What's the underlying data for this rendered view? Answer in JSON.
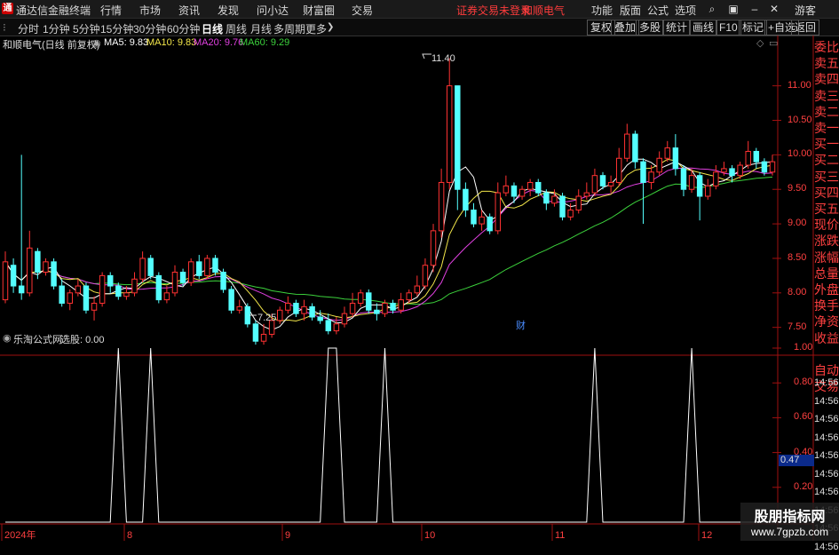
{
  "titlebar": {
    "app_name": "通达信金融终端",
    "menus": [
      "行情",
      "市场",
      "资讯",
      "发现",
      "问小达",
      "财富圈",
      "交易"
    ],
    "warning": "证券交易未登录",
    "stock_name": "和顺电气",
    "right_menus": [
      "功能",
      "版面",
      "公式",
      "选项"
    ],
    "guest": "游客"
  },
  "toolbar": {
    "periods": [
      "分时",
      "1分钟",
      "5分钟",
      "15分钟",
      "30分钟",
      "60分钟",
      "日线",
      "周线",
      "月线",
      "多周期",
      "更多"
    ],
    "active_period": "日线",
    "right_buttons": [
      "复权",
      "叠加",
      "多股",
      "统计",
      "画线",
      "F10",
      "标记",
      "+自选",
      "返回"
    ]
  },
  "main_chart": {
    "title": "和顺电气(日线 前复权)",
    "ma_labels": [
      {
        "text": "MA5: 9.83",
        "color": "#ffffff"
      },
      {
        "text": "MA10: 9.83",
        "color": "#f2e64a"
      },
      {
        "text": "MA20: 9.76",
        "color": "#e040e0"
      },
      {
        "text": "MA60: 9.29",
        "color": "#3cd23c"
      }
    ],
    "high_label": "11.40",
    "low_label": "7.25",
    "event_marker": "财",
    "y_ticks": [
      "11.00",
      "10.50",
      "10.00",
      "9.50",
      "9.00",
      "8.50",
      "8.00",
      "7.50"
    ]
  },
  "sub_chart": {
    "title": "乐淘公式网",
    "value_label": "选股: 0.00",
    "y_ticks": [
      "1.00",
      "0.80",
      "0.60",
      "0.40",
      "0.20"
    ],
    "current_value": "0.47"
  },
  "x_axis": {
    "labels": [
      "2024年",
      "8",
      "9",
      "10",
      "11",
      "12"
    ]
  },
  "right_panel": {
    "items": [
      "委比",
      "卖五",
      "卖四",
      "卖三",
      "卖二",
      "卖一",
      "买一",
      "买二",
      "买三",
      "买四",
      "买五",
      "现价",
      "涨跌",
      "涨幅",
      "总量",
      "外盘",
      "换手",
      "净资",
      "收益",
      "自动",
      "交易",
      "14:56",
      "14:56",
      "14:56",
      "14:56",
      "14:56",
      "14:56",
      "14:56",
      "14:56",
      "14:56",
      "14:56"
    ]
  },
  "watermark": {
    "line1": "股朋指标网",
    "line2": "www.7gpzb.com"
  },
  "chart_data": {
    "type": "candlestick",
    "y_range": [
      7.2,
      11.6
    ],
    "candles": [
      [
        7.9,
        8.45,
        8.6,
        7.85
      ],
      [
        8.4,
        8.1,
        8.5,
        8.0
      ],
      [
        8.1,
        8.0,
        10.0,
        7.9
      ],
      [
        8.0,
        8.65,
        8.9,
        7.95
      ],
      [
        8.6,
        8.3,
        8.65,
        8.2
      ],
      [
        8.3,
        8.45,
        8.5,
        8.25
      ],
      [
        8.45,
        8.1,
        8.5,
        8.05
      ],
      [
        8.1,
        7.85,
        8.2,
        7.8
      ],
      [
        7.85,
        8.0,
        8.05,
        7.75
      ],
      [
        8.0,
        8.1,
        8.2,
        7.95
      ],
      [
        8.1,
        7.75,
        8.15,
        7.7
      ],
      [
        7.75,
        7.85,
        7.95,
        7.6
      ],
      [
        7.85,
        8.25,
        8.3,
        7.8
      ],
      [
        8.25,
        8.1,
        8.3,
        8.0
      ],
      [
        8.1,
        7.95,
        8.15,
        7.9
      ],
      [
        7.95,
        8.0,
        8.1,
        7.9
      ],
      [
        8.0,
        8.2,
        8.3,
        7.95
      ],
      [
        8.2,
        8.5,
        8.6,
        8.15
      ],
      [
        8.5,
        8.25,
        8.55,
        8.2
      ],
      [
        8.25,
        7.9,
        8.3,
        7.85
      ],
      [
        7.9,
        8.0,
        8.1,
        7.85
      ],
      [
        8.0,
        8.3,
        8.4,
        7.95
      ],
      [
        8.3,
        8.15,
        8.35,
        8.1
      ],
      [
        8.15,
        8.45,
        8.5,
        8.1
      ],
      [
        8.45,
        8.25,
        8.55,
        8.2
      ],
      [
        8.25,
        8.5,
        8.55,
        8.2
      ],
      [
        8.5,
        8.3,
        8.55,
        8.25
      ],
      [
        8.3,
        8.05,
        8.35,
        8.0
      ],
      [
        8.05,
        7.75,
        8.1,
        7.7
      ],
      [
        7.75,
        7.8,
        7.9,
        7.7
      ],
      [
        7.8,
        7.55,
        7.85,
        7.5
      ],
      [
        7.55,
        7.3,
        7.6,
        7.25
      ],
      [
        7.3,
        7.4,
        7.55,
        7.25
      ],
      [
        7.4,
        7.6,
        7.7,
        7.35
      ],
      [
        7.6,
        7.75,
        7.8,
        7.55
      ],
      [
        7.75,
        7.85,
        7.95,
        7.7
      ],
      [
        7.85,
        7.7,
        7.9,
        7.65
      ],
      [
        7.7,
        7.8,
        7.9,
        7.6
      ],
      [
        7.8,
        7.65,
        7.85,
        7.6
      ],
      [
        7.65,
        7.6,
        7.75,
        7.55
      ],
      [
        7.6,
        7.45,
        7.7,
        7.4
      ],
      [
        7.45,
        7.55,
        7.65,
        7.4
      ],
      [
        7.55,
        7.7,
        7.8,
        7.5
      ],
      [
        7.7,
        7.85,
        8.0,
        7.65
      ],
      [
        7.85,
        8.0,
        8.05,
        7.8
      ],
      [
        8.0,
        7.75,
        8.05,
        7.7
      ],
      [
        7.75,
        7.7,
        7.85,
        7.6
      ],
      [
        7.7,
        7.85,
        7.9,
        7.65
      ],
      [
        7.85,
        7.75,
        7.9,
        7.7
      ],
      [
        7.75,
        7.9,
        8.0,
        7.7
      ],
      [
        7.9,
        8.0,
        8.05,
        7.85
      ],
      [
        8.0,
        8.1,
        8.25,
        7.95
      ],
      [
        8.1,
        8.4,
        8.5,
        8.05
      ],
      [
        8.4,
        8.9,
        9.0,
        8.3
      ],
      [
        8.9,
        9.6,
        9.8,
        8.8
      ],
      [
        9.6,
        11.0,
        11.4,
        9.5
      ],
      [
        11.0,
        9.5,
        10.2,
        9.2
      ],
      [
        9.5,
        9.2,
        9.6,
        9.1
      ],
      [
        9.2,
        9.0,
        9.3,
        8.95
      ],
      [
        9.0,
        9.1,
        9.2,
        8.9
      ],
      [
        9.1,
        8.9,
        9.15,
        8.85
      ],
      [
        8.9,
        9.45,
        9.6,
        8.85
      ],
      [
        9.45,
        9.55,
        9.7,
        9.4
      ],
      [
        9.55,
        9.4,
        9.6,
        9.3
      ],
      [
        9.4,
        9.5,
        9.55,
        9.35
      ],
      [
        9.5,
        9.6,
        9.65,
        9.4
      ],
      [
        9.6,
        9.45,
        9.65,
        9.4
      ],
      [
        9.45,
        9.3,
        9.5,
        9.2
      ],
      [
        9.3,
        9.4,
        9.5,
        9.25
      ],
      [
        9.4,
        9.1,
        9.45,
        9.05
      ],
      [
        9.1,
        9.2,
        9.3,
        9.05
      ],
      [
        9.2,
        9.4,
        9.5,
        9.15
      ],
      [
        9.4,
        9.45,
        9.6,
        9.35
      ],
      [
        9.45,
        9.7,
        9.8,
        9.4
      ],
      [
        9.7,
        9.55,
        9.75,
        9.5
      ],
      [
        9.55,
        9.6,
        9.7,
        9.45
      ],
      [
        9.6,
        9.95,
        10.1,
        9.55
      ],
      [
        9.95,
        10.3,
        10.45,
        9.9
      ],
      [
        10.3,
        9.9,
        10.35,
        9.8
      ],
      [
        9.9,
        9.6,
        9.95,
        9.0
      ],
      [
        9.6,
        9.75,
        9.85,
        9.5
      ],
      [
        9.75,
        9.95,
        10.05,
        9.7
      ],
      [
        9.95,
        10.1,
        10.2,
        9.9
      ],
      [
        10.1,
        9.8,
        10.3,
        9.7
      ],
      [
        9.8,
        9.5,
        9.85,
        9.4
      ],
      [
        9.5,
        9.7,
        9.8,
        9.45
      ],
      [
        9.7,
        9.4,
        9.75,
        9.05
      ],
      [
        9.4,
        9.55,
        9.65,
        9.35
      ],
      [
        9.55,
        9.75,
        9.85,
        9.5
      ],
      [
        9.75,
        9.8,
        9.9,
        9.7
      ],
      [
        9.8,
        9.7,
        9.85,
        9.6
      ],
      [
        9.7,
        9.85,
        9.9,
        9.65
      ],
      [
        9.85,
        10.05,
        10.2,
        9.8
      ],
      [
        10.05,
        9.9,
        10.1,
        9.8
      ],
      [
        9.9,
        9.75,
        9.95,
        9.7
      ],
      [
        9.75,
        9.9,
        10.0,
        9.7
      ]
    ],
    "ma_colors": {
      "ma5": "#ffffff",
      "ma10": "#f2e64a",
      "ma20": "#e040e0",
      "ma60": "#3cd23c"
    },
    "signal_peaks_index": [
      14,
      18,
      40,
      47,
      73,
      85
    ],
    "signal_flat_run": [
      40,
      41
    ]
  }
}
